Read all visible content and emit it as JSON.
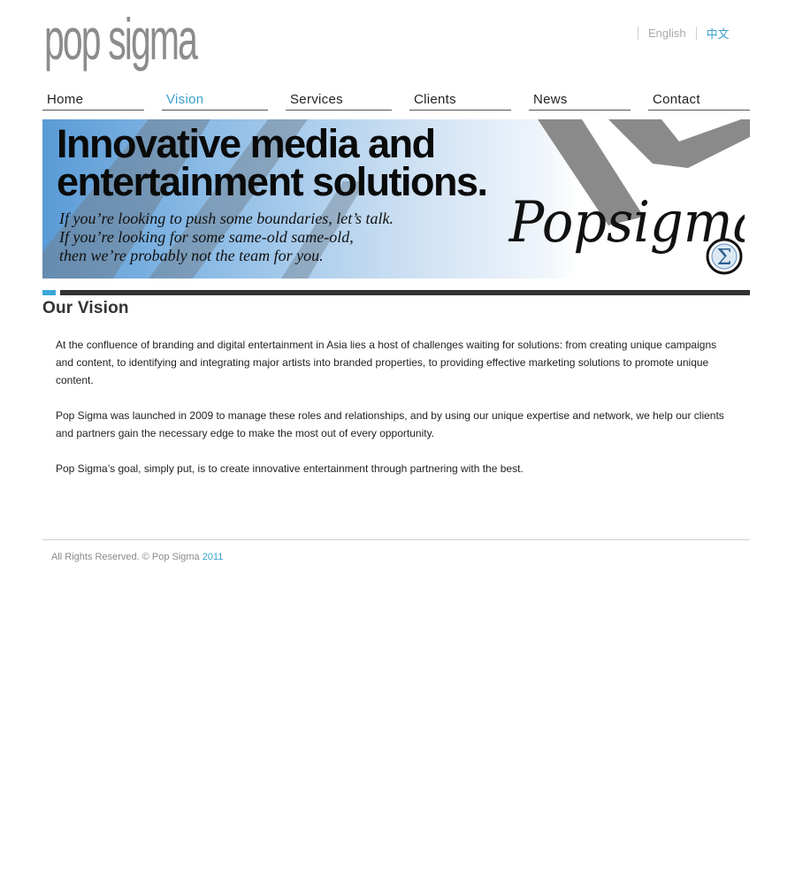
{
  "brand": {
    "logo_text": "pop sigma"
  },
  "language": {
    "english_label": "English",
    "chinese_label": "中文"
  },
  "nav": [
    {
      "label": "Home"
    },
    {
      "label": "Vision"
    },
    {
      "label": "Services"
    },
    {
      "label": "Clients"
    },
    {
      "label": "News"
    },
    {
      "label": "Contact"
    }
  ],
  "nav_active": "Vision",
  "banner": {
    "headline_line1": "Innovative media and",
    "headline_line2": "entertainment solutions.",
    "tagline_line1": "If you’re looking to push some boundaries, let’s talk.",
    "tagline_line2": "If you’re looking for some same-old same-old,",
    "tagline_line3": "then we’re probably not the team for you.",
    "signature_text": "Popsigma",
    "sigma_symbol": "Σ"
  },
  "page": {
    "title": "Our Vision",
    "paragraphs": [
      "At the confluence of branding and digital entertainment in Asia lies a host of challenges waiting for solutions: from creating unique campaigns and content, to identifying and integrating major artists into branded properties, to providing effective marketing solutions to promote unique content.",
      "Pop Sigma was launched in 2009 to manage these roles and relationships, and by using our unique expertise and network, we help our clients and partners gain the necessary edge to make the most out of every opportunity.",
      "Pop Sigma’s goal, simply put, is to create innovative entertainment through partnering with the best."
    ]
  },
  "footer": {
    "text": "All Rights Reserved. © Pop Sigma ",
    "year": "2011"
  },
  "colors": {
    "accent": "#3aa0cf",
    "dark_bar": "#333333",
    "logo_gray": "#8c8c8c"
  }
}
